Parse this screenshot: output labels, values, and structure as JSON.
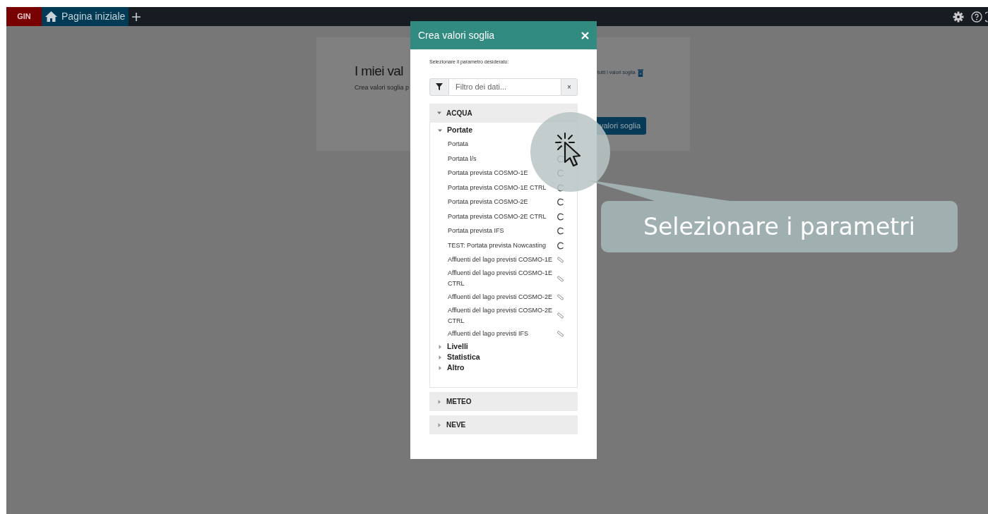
{
  "top_bar": {
    "brand": "GIN",
    "tabs": [
      {
        "label": "Pagina iniziale",
        "selected": true
      }
    ]
  },
  "background_page": {
    "title": "I miei val",
    "subtitle": "Crea valori soglia p",
    "delete_all_link": "tutti i valori soglia",
    "create_button": "valori soglia"
  },
  "dialog": {
    "title": "Crea valori soglia",
    "instruction": "Selezionare il parametro desiderato:",
    "filter": {
      "placeholder": "Filtro dei dati..."
    },
    "clear_button": "×",
    "groups": [
      {
        "label": "ACQUA",
        "expanded": true,
        "children": [
          {
            "label": "Portate",
            "expanded": true,
            "children": [
              {
                "label": "Portata",
                "kind": "circle"
              },
              {
                "label": "Portata l/s",
                "kind": "circle"
              },
              {
                "label": "Portata prevista COSMO-1E",
                "kind": "circle"
              },
              {
                "label": "Portata prevista COSMO-1E CTRL",
                "kind": "circle"
              },
              {
                "label": "Portata prevista COSMO-2E",
                "kind": "circle"
              },
              {
                "label": "Portata prevista COSMO-2E CTRL",
                "kind": "circle"
              },
              {
                "label": "Portata prevista IFS",
                "kind": "circle"
              },
              {
                "label": "TEST: Portata prevista Nowcasting",
                "kind": "circle"
              },
              {
                "label": "Affluenti del lago previsti COSMO-1E",
                "kind": "tag"
              },
              {
                "label": "Affluenti del lago previsti COSMO-1E CTRL",
                "kind": "tag"
              },
              {
                "label": "Affluenti del lago previsti COSMO-2E",
                "kind": "tag"
              },
              {
                "label": "Affluenti del lago previsti COSMO-2E CTRL",
                "kind": "tag"
              },
              {
                "label": "Affluenti del lago previsti IFS",
                "kind": "tag"
              }
            ]
          },
          {
            "label": "Livelli",
            "expanded": false
          },
          {
            "label": "Statistica",
            "expanded": false
          },
          {
            "label": "Altro",
            "expanded": false
          }
        ]
      },
      {
        "label": "METEO",
        "expanded": false
      },
      {
        "label": "NEVE",
        "expanded": false
      }
    ]
  },
  "callout": {
    "text": "Selezionare i parametri"
  }
}
